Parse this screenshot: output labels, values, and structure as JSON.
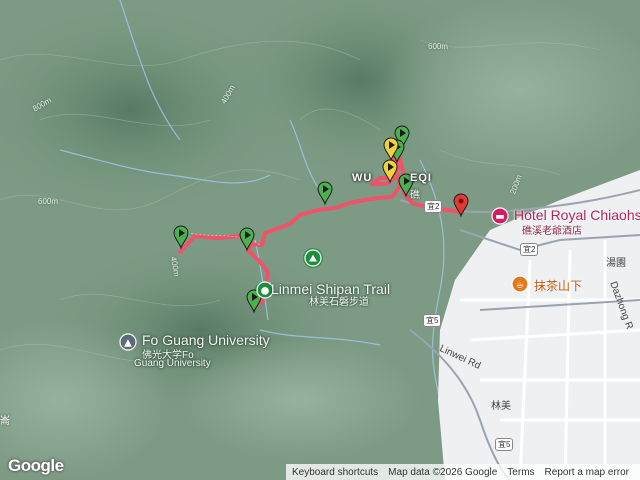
{
  "map": {
    "labels": {
      "trail_en": "Linmei Shipan Trail",
      "trail_zh": "林美石磐步道",
      "university_en": "Fo Guang University",
      "university_zh_1": "佛光大学Fo",
      "university_zh_2": "Guang University",
      "town": "WU",
      "town_2": "EQI",
      "town_zh": "礁",
      "hotel_en": "Hotel Royal Chiaohs",
      "hotel_zh": "礁溪老爺酒店",
      "tea_shop": "抹茶山下",
      "district_linmei": "林美",
      "road_linwei": "Linwei Rd",
      "road_dazhong": "Dazhong R",
      "road_dazhong_zh": "湯園",
      "edge_char": "崙",
      "elev_600_top": "600m",
      "elev_800": "800m",
      "elev_600_left": "600m",
      "elev_400": "400m",
      "elev_200": "200m",
      "elev_400_b": "400m"
    },
    "shields": {
      "yi2_a": "宜2",
      "yi2_b": "宜2",
      "yi5_a": "宜5",
      "yi5_b": "宜5"
    },
    "markers": [
      {
        "type": "green-flag"
      },
      {
        "type": "green-flag"
      },
      {
        "type": "green-flag"
      },
      {
        "type": "green-flag"
      },
      {
        "type": "green-flag"
      },
      {
        "type": "green-flag"
      },
      {
        "type": "green-flag"
      },
      {
        "type": "yellow-flag"
      },
      {
        "type": "yellow-flag"
      },
      {
        "type": "red-flag"
      }
    ],
    "colors": {
      "route": "#f0526a",
      "terrain": "#6f8f78",
      "urban": "#eceef0",
      "green_marker": "#4caf50",
      "yellow_marker": "#f2d23a",
      "red_marker": "#e53935",
      "hotel": "#d81b60",
      "park": "#1e8e3e"
    }
  },
  "footer": {
    "google": "Google",
    "keyboard_shortcuts": "Keyboard shortcuts",
    "map_data": "Map data ©2026 Google",
    "terms": "Terms",
    "report": "Report a map error"
  }
}
